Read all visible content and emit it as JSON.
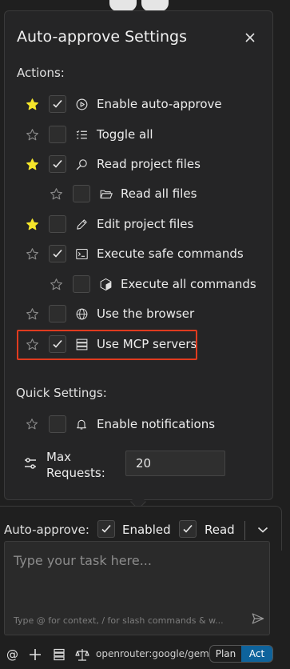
{
  "panel": {
    "title": "Auto-approve Settings",
    "actions_label": "Actions:",
    "quick_label": "Quick Settings:",
    "actions": [
      {
        "label": "Enable auto-approve",
        "starred": true,
        "checked": true,
        "icon": "play-circle-icon"
      },
      {
        "label": "Toggle all",
        "starred": false,
        "checked": false,
        "icon": "list-check-icon"
      },
      {
        "label": "Read project files",
        "starred": true,
        "checked": true,
        "icon": "search-icon"
      },
      {
        "label": "Read all files",
        "starred": false,
        "checked": false,
        "icon": "folder-open-icon"
      },
      {
        "label": "Edit project files",
        "starred": true,
        "checked": false,
        "icon": "pencil-icon"
      },
      {
        "label": "Execute safe commands",
        "starred": false,
        "checked": true,
        "icon": "terminal-icon"
      },
      {
        "label": "Execute all commands",
        "starred": false,
        "checked": false,
        "icon": "cube-icon"
      },
      {
        "label": "Use the browser",
        "starred": false,
        "checked": false,
        "icon": "globe-icon"
      },
      {
        "label": "Use MCP servers",
        "starred": false,
        "checked": true,
        "icon": "server-icon"
      }
    ],
    "quick": {
      "notifications_label": "Enable notifications",
      "notifications_checked": false,
      "max_requests_label_1": "Max",
      "max_requests_label_2": "Requests:",
      "max_requests_value": "20"
    }
  },
  "approve_bar": {
    "label": "Auto-approve:",
    "items": [
      {
        "label": "Enabled",
        "checked": true
      },
      {
        "label": "Read",
        "checked": true
      }
    ]
  },
  "task": {
    "placeholder": "Type your task here...",
    "hint": "Type @ for context, / for slash commands & w..."
  },
  "bottom": {
    "model": "openrouter:google/gem...",
    "plan_label": "Plan",
    "act_label": "Act"
  },
  "colors": {
    "star_active": "#f5e62b",
    "highlight": "#e03b1f",
    "act_bg": "#0e639c"
  }
}
